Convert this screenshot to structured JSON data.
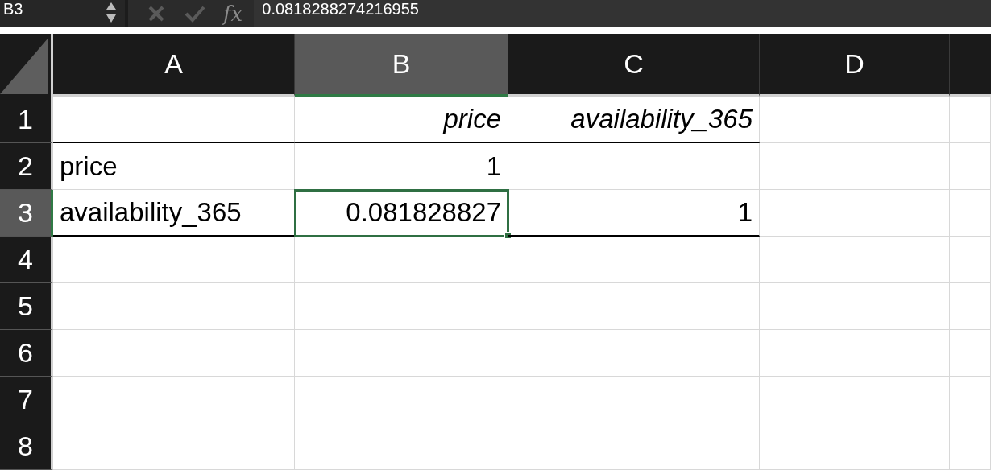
{
  "formula_bar": {
    "name_box": "B3",
    "function_label": "fx",
    "value": "0.0818288274216955"
  },
  "columns": [
    {
      "label": "A",
      "selected": false
    },
    {
      "label": "B",
      "selected": true
    },
    {
      "label": "C",
      "selected": false
    },
    {
      "label": "D",
      "selected": false
    }
  ],
  "rows": [
    {
      "label": "1",
      "selected": false,
      "ruled": true,
      "cells": [
        {
          "selected": false
        },
        {
          "text": "price",
          "kind": "heading",
          "selected": false
        },
        {
          "text": "availability_365",
          "kind": "heading",
          "selected": false
        }
      ]
    },
    {
      "label": "2",
      "selected": false,
      "ruled": false,
      "cells": [
        {
          "text": "price",
          "kind": "label",
          "selected": false
        },
        {
          "text": "1",
          "kind": "number",
          "selected": false
        },
        {
          "selected": false
        }
      ]
    },
    {
      "label": "3",
      "selected": true,
      "ruled": true,
      "cells": [
        {
          "text": "availability_365",
          "kind": "label",
          "selected": false
        },
        {
          "text": "0.081828827",
          "kind": "number",
          "selected": true
        },
        {
          "text": "1",
          "kind": "number",
          "selected": false
        }
      ]
    },
    {
      "label": "4",
      "selected": false,
      "ruled": false,
      "cells": []
    },
    {
      "label": "5",
      "selected": false,
      "ruled": false,
      "cells": []
    },
    {
      "label": "6",
      "selected": false,
      "ruled": false,
      "cells": []
    },
    {
      "label": "7",
      "selected": false,
      "ruled": false,
      "cells": []
    },
    {
      "label": "8",
      "selected": false,
      "ruled": false,
      "cells": []
    }
  ]
}
